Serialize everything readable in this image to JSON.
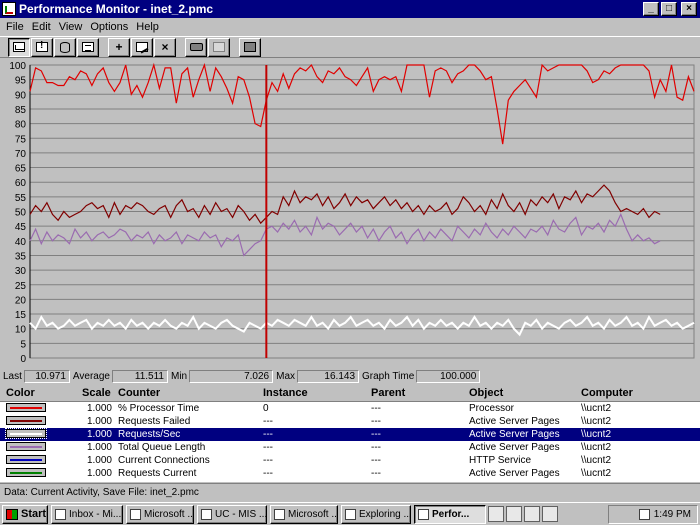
{
  "window": {
    "title": "Performance Monitor - inet_2.pmc"
  },
  "menu": [
    "File",
    "Edit",
    "View",
    "Options",
    "Help"
  ],
  "toolbar": {
    "buttons": [
      "chart-view-icon",
      "alert-view-icon",
      "log-view-icon",
      "report-view-icon",
      "add-counter-icon",
      "edit-counter-icon",
      "delete-counter-icon",
      "update-now-icon",
      "bookmark-icon",
      "options-icon"
    ]
  },
  "chart_data": {
    "type": "line",
    "title": "",
    "xlabel": "",
    "ylabel": "",
    "ylim": [
      0,
      100
    ],
    "yticks": [
      0,
      5,
      10,
      15,
      20,
      25,
      30,
      35,
      40,
      45,
      50,
      55,
      60,
      65,
      70,
      75,
      80,
      85,
      90,
      95,
      100
    ],
    "grid": true,
    "graph_time": 100,
    "current_sample_index": 42,
    "series": [
      {
        "color": "#e00000",
        "values": [
          91,
          99,
          98,
          94,
          94,
          93,
          93,
          96,
          95,
          98,
          97,
          93,
          97,
          99,
          94,
          91,
          94,
          100,
          90,
          93,
          89,
          94,
          100,
          92,
          99,
          99,
          87,
          97,
          99,
          89,
          95,
          100,
          91,
          99,
          96,
          92,
          87,
          96,
          95,
          89,
          80,
          79,
          88,
          94,
          91,
          97,
          92,
          97,
          99,
          98,
          100,
          96,
          94,
          98,
          97,
          99,
          96,
          95,
          93,
          96,
          99,
          91,
          95,
          96,
          95,
          96,
          91,
          100,
          100,
          100,
          100,
          89,
          98,
          99,
          98,
          94,
          97,
          98,
          100,
          100,
          98,
          95,
          96,
          85,
          73,
          88,
          91,
          93,
          95,
          92,
          89,
          100,
          98,
          99,
          100,
          100,
          100,
          100,
          100,
          98,
          94,
          95,
          98,
          97,
          99,
          100,
          100,
          100,
          100,
          100,
          98,
          89,
          95,
          91,
          100,
          89,
          88,
          96,
          91
        ]
      },
      {
        "color": "#800000",
        "values": [
          49,
          52,
          50,
          53,
          49,
          47,
          50,
          48,
          49,
          50,
          52,
          53,
          51,
          52,
          48,
          53,
          49,
          52,
          51,
          53,
          52,
          50,
          49,
          51,
          52,
          48,
          52,
          54,
          50,
          51,
          48,
          52,
          49,
          53,
          50,
          51,
          48,
          52,
          50,
          47,
          49,
          46,
          48,
          50,
          49,
          55,
          52,
          57,
          53,
          55,
          54,
          56,
          52,
          55,
          51,
          53,
          56,
          52,
          55,
          53,
          54,
          51,
          53,
          55,
          52,
          54,
          51,
          53,
          50,
          52,
          49,
          52,
          50,
          51,
          53,
          49,
          51,
          55,
          53,
          50,
          52,
          49,
          54,
          51,
          56,
          52,
          50,
          53,
          49,
          54,
          52,
          55,
          53,
          56,
          51,
          55,
          54,
          57,
          53,
          56,
          55,
          57,
          59,
          57,
          53,
          50,
          51,
          50,
          49,
          51,
          48,
          50,
          49
        ]
      },
      {
        "color": "#9a6bb0",
        "values": [
          40,
          44,
          39,
          43,
          40,
          42,
          41,
          39,
          44,
          41,
          43,
          40,
          42,
          43,
          41,
          42,
          44,
          43,
          40,
          42,
          41,
          43,
          39,
          42,
          40,
          41,
          43,
          39,
          42,
          41,
          40,
          43,
          41,
          42,
          38,
          41,
          40,
          42,
          35,
          37,
          39,
          40,
          44,
          45,
          43,
          46,
          44,
          47,
          43,
          45,
          42,
          48,
          44,
          46,
          45,
          42,
          44,
          46,
          43,
          45,
          41,
          44,
          40,
          43,
          45,
          41,
          43,
          39,
          42,
          44,
          40,
          43,
          41,
          44,
          42,
          40,
          45,
          43,
          41,
          44,
          42,
          46,
          43,
          41,
          44,
          42,
          45,
          43,
          41,
          44,
          43,
          45,
          42,
          47,
          44,
          43,
          46,
          48,
          42,
          45,
          44,
          46,
          43,
          47,
          45,
          49,
          44,
          40,
          42,
          40,
          41,
          39,
          40
        ]
      },
      {
        "color": "#ffffff",
        "values": [
          12,
          10,
          14,
          11,
          12,
          10,
          11,
          13,
          11,
          12,
          13,
          10,
          12,
          11,
          13,
          11,
          12,
          10,
          13,
          11,
          12,
          10,
          12,
          11,
          13,
          11,
          10,
          12,
          11,
          14,
          10,
          12,
          11,
          10,
          12,
          13,
          11,
          10,
          9,
          12,
          11,
          10,
          12,
          11,
          13,
          12,
          11,
          13,
          12,
          11,
          14,
          11,
          12,
          10,
          13,
          11,
          12,
          14,
          11,
          12,
          13,
          11,
          12,
          10,
          13,
          11,
          12,
          14,
          11,
          13,
          10,
          12,
          11,
          13,
          11,
          12,
          10,
          12,
          11,
          14,
          11,
          12,
          10,
          12,
          11,
          13,
          10,
          8,
          12,
          11,
          13,
          10,
          12,
          11,
          10,
          12,
          13,
          11,
          12,
          14,
          11,
          12,
          10,
          13,
          11,
          12,
          14,
          11,
          12,
          10,
          14,
          11,
          12,
          13,
          11,
          12,
          10,
          11,
          12
        ]
      }
    ]
  },
  "values_bar": {
    "last_label": "Last",
    "last": "10.971",
    "avg_label": "Average",
    "avg": "11.511",
    "min_label": "Min",
    "min": "7.026",
    "max_label": "Max",
    "max": "16.143",
    "gt_label": "Graph Time",
    "gt": "100.000"
  },
  "legend": {
    "headers": {
      "color": "Color",
      "scale": "Scale",
      "counter": "Counter",
      "instance": "Instance",
      "parent": "Parent",
      "object": "Object",
      "computer": "Computer"
    },
    "rows": [
      {
        "swatch": "#e00000",
        "scale": "1.000",
        "counter": "% Processor Time",
        "instance": "0",
        "parent": "---",
        "object": "Processor",
        "computer": "\\\\ucnt2"
      },
      {
        "swatch": "#800000",
        "scale": "1.000",
        "counter": "Requests Failed",
        "instance": "---",
        "parent": "---",
        "object": "Active Server Pages",
        "computer": "\\\\ucnt2"
      },
      {
        "swatch": "#ffffff",
        "scale": "1.000",
        "counter": "Requests/Sec",
        "instance": "---",
        "parent": "---",
        "object": "Active Server Pages",
        "computer": "\\\\ucnt2"
      },
      {
        "swatch": "#9a6bb0",
        "scale": "1.000",
        "counter": "Total Queue Length",
        "instance": "---",
        "parent": "---",
        "object": "Active Server Pages",
        "computer": "\\\\ucnt2"
      },
      {
        "swatch": "#0000c0",
        "scale": "1.000",
        "counter": "Current Connections",
        "instance": "---",
        "parent": "---",
        "object": "HTTP Service",
        "computer": "\\\\ucnt2"
      },
      {
        "swatch": "#008000",
        "scale": "1.000",
        "counter": "Requests Current",
        "instance": "---",
        "parent": "---",
        "object": "Active Server Pages",
        "computer": "\\\\ucnt2"
      }
    ],
    "selected_index": 2
  },
  "status": {
    "text": "Data: Current Activity, Save File: inet_2.pmc"
  },
  "taskbar": {
    "start": "Start",
    "tasks": [
      "Inbox - Mi...",
      "Microsoft ...",
      "UC - MIS ...",
      "Microsoft ...",
      "Exploring ...",
      "Perfor..."
    ],
    "active_index": 5,
    "clock": "1:49 PM"
  }
}
